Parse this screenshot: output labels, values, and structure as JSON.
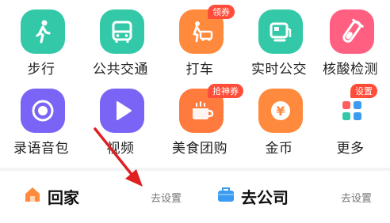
{
  "grid": {
    "row1": [
      {
        "label": "步行",
        "icon": "walk-icon",
        "color": "#33c9a8"
      },
      {
        "label": "公共交通",
        "icon": "bus-icon",
        "color": "#33c9a8"
      },
      {
        "label": "打车",
        "icon": "taxi-icon",
        "color": "#ff8a3d",
        "badge": "领券"
      },
      {
        "label": "实时公交",
        "icon": "realtime-bus-icon",
        "color": "#33c9a8"
      },
      {
        "label": "核酸检测",
        "icon": "test-tube-icon",
        "color": "#ff5f80"
      }
    ],
    "row2": [
      {
        "label": "录语音包",
        "icon": "record-icon",
        "color": "#7a64f5"
      },
      {
        "label": "视频",
        "icon": "play-icon",
        "color": "#7a64f5"
      },
      {
        "label": "美食团购",
        "icon": "food-icon",
        "color": "#ff7a3d",
        "badge": "抢神券"
      },
      {
        "label": "金币",
        "icon": "coin-icon",
        "color": "#ff8a3d"
      },
      {
        "label": "更多",
        "icon": "more-grid-icon",
        "color": "#ffffff",
        "badge": "设置"
      }
    ]
  },
  "shortcuts": {
    "home": {
      "title": "回家",
      "action": "去设置",
      "icon": "home-icon",
      "icon_color": "#ff8a3d"
    },
    "company": {
      "title": "去公司",
      "action": "去设置",
      "icon": "briefcase-icon",
      "icon_color": "#3a9bf0"
    }
  }
}
